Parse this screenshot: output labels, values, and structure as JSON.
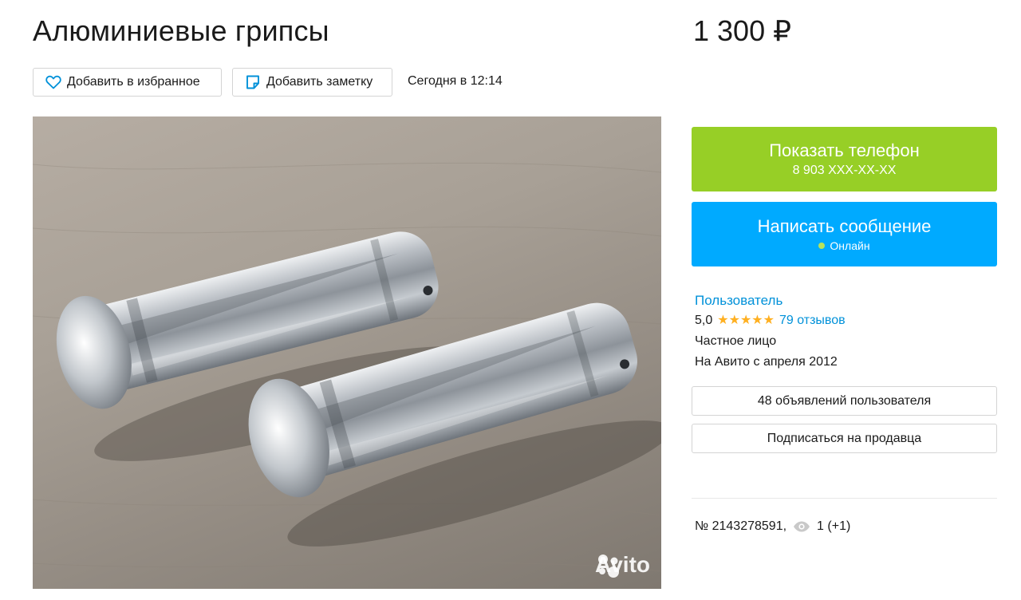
{
  "listing": {
    "title": "Алюминиевые грипсы",
    "price": "1 300 ₽",
    "timestamp": "Сегодня в 12:14"
  },
  "actions": {
    "favorite_label": "Добавить в избранное",
    "note_label": "Добавить заметку"
  },
  "photo": {
    "watermark": "Avito"
  },
  "contact": {
    "phone_button_label": "Показать телефон",
    "phone_masked": "8 903 XXX-XX-XX",
    "message_button_label": "Написать сообщение",
    "online_status": "Онлайн"
  },
  "seller": {
    "name": "Пользователь",
    "rating": "5,0",
    "stars": "★★★★★",
    "reviews": "79 отзывов",
    "type": "Частное лицо",
    "since": "На Авито с апреля 2012",
    "ads_button_label": "48 объявлений пользователя",
    "subscribe_button_label": "Подписаться на продавца"
  },
  "meta": {
    "listing_number": "№ 2143278591,",
    "views": "1 (+1)"
  },
  "colors": {
    "phone_button": "#97cf26",
    "message_button": "#00aaff",
    "link": "#0091d9",
    "stars": "#ffb021",
    "online_dot": "#b7e35a"
  },
  "icons": {
    "favorite": "heart-icon",
    "note": "note-icon",
    "views": "eye-icon",
    "watermark_logo": "avito-logo-icon"
  }
}
